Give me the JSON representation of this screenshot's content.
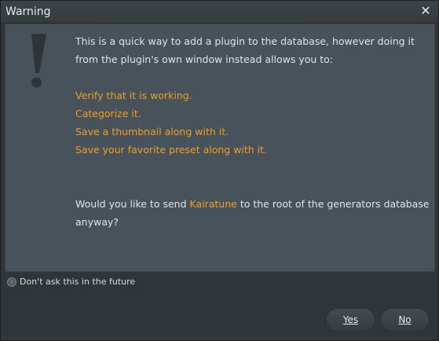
{
  "window": {
    "title": "Warning",
    "close_glyph": "✕"
  },
  "message": {
    "intro": "This is a quick way to add a plugin to the database, however doing it from the plugin's own window instead allows you to:",
    "benefits": [
      "Verify that it is working.",
      "Categorize it.",
      "Save a thumbnail along with it.",
      "Save your favorite preset along with it."
    ],
    "question_before": "Would you like to send ",
    "plugin_name": "Kairatune",
    "question_after": " to the root of the generators database anyway?"
  },
  "options": {
    "dont_ask_label": "Don't ask this in the future",
    "dont_ask_checked": false
  },
  "buttons": {
    "yes_label": "Yes",
    "no_label": "No"
  },
  "icons": {
    "warning": "exclamation-icon",
    "close": "close-icon",
    "checkbox": "radio-checkbox-icon"
  },
  "colors": {
    "accent": "#f19e22",
    "text": "#e1e4e6",
    "panel": "#47525a",
    "window": "#2f3539"
  }
}
